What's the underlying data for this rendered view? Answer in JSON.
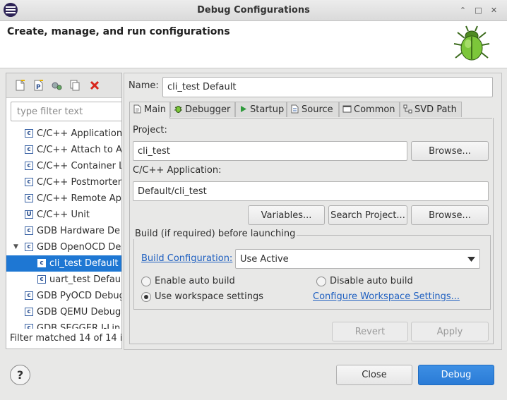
{
  "window": {
    "title": "Debug Configurations",
    "controls": [
      "chevron-up-icon",
      "restore-icon",
      "close-icon"
    ]
  },
  "header": {
    "title": "Create, manage, and run configurations"
  },
  "left_toolbar": {
    "icons": [
      "new-configuration-icon",
      "new-prototype-icon",
      "export-icon",
      "duplicate-icon",
      "delete-icon"
    ]
  },
  "filter": {
    "placeholder": "type filter text",
    "status": "Filter matched 14 of 14 i"
  },
  "tree": {
    "items": [
      {
        "label": "C/C++ Application",
        "icon": "c-config-icon",
        "level": 0
      },
      {
        "label": "C/C++ Attach to A",
        "icon": "c-config-icon",
        "level": 0
      },
      {
        "label": "C/C++ Container L",
        "icon": "c-config-icon",
        "level": 0
      },
      {
        "label": "C/C++ Postmorten",
        "icon": "c-config-icon",
        "level": 0
      },
      {
        "label": "C/C++ Remote Ap",
        "icon": "c-config-icon",
        "level": 0
      },
      {
        "label": "C/C++ Unit",
        "icon": "c-unit-icon",
        "level": 0
      },
      {
        "label": "GDB Hardware De",
        "icon": "c-config-icon",
        "level": 0
      },
      {
        "label": "GDB OpenOCD De",
        "icon": "c-config-icon",
        "level": 0,
        "expanded": true
      },
      {
        "label": "cli_test Default",
        "icon": "c-config-icon",
        "level": 1,
        "selected": true
      },
      {
        "label": "uart_test Defau",
        "icon": "c-config-icon",
        "level": 1
      },
      {
        "label": "GDB PyOCD Debug",
        "icon": "c-config-icon",
        "level": 0
      },
      {
        "label": "GDB QEMU Debug",
        "icon": "c-config-icon",
        "level": 0
      },
      {
        "label": "GDB SEGGER J-Lin",
        "icon": "c-config-icon",
        "level": 0
      }
    ]
  },
  "config": {
    "name_label": "Name:",
    "name_value": "cli_test Default",
    "tabs": [
      {
        "label": "Main",
        "icon": "main-tab-icon",
        "active": true
      },
      {
        "label": "Debugger",
        "icon": "debugger-tab-icon"
      },
      {
        "label": "Startup",
        "icon": "startup-tab-icon"
      },
      {
        "label": "Source",
        "icon": "source-tab-icon"
      },
      {
        "label": "Common",
        "icon": "common-tab-icon"
      },
      {
        "label": "SVD Path",
        "icon": "svd-path-tab-icon"
      }
    ],
    "main": {
      "project_label": "Project:",
      "project_value": "cli_test",
      "browse_label": "Browse...",
      "application_label": "C/C++ Application:",
      "application_value": "Default/cli_test",
      "variables_label": "Variables...",
      "search_project_label": "Search Project...",
      "browse2_label": "Browse...",
      "build_group_label": "Build (if required) before launching",
      "build_config_link": "Build Configuration:",
      "build_config_value": "Use Active",
      "radios": {
        "enable_auto_build": {
          "label": "Enable auto build",
          "checked": false
        },
        "disable_auto_build": {
          "label": "Disable auto build",
          "checked": false
        },
        "use_workspace_settings": {
          "label": "Use workspace settings",
          "checked": true
        }
      },
      "configure_link": "Configure Workspace Settings..."
    },
    "revert_label": "Revert",
    "apply_label": "Apply"
  },
  "footer": {
    "help_label": "?",
    "close_label": "Close",
    "debug_label": "Debug"
  }
}
